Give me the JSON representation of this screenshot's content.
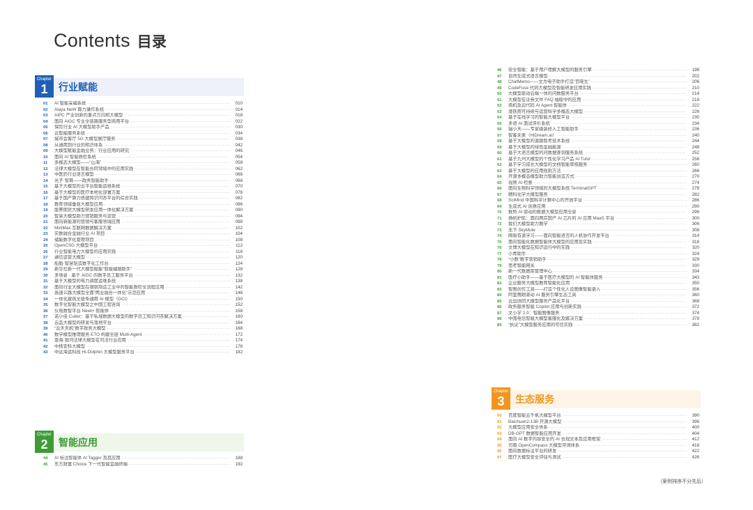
{
  "title": {
    "en": "Contents",
    "cn": "目录"
  },
  "chapters": [
    {
      "label": "Chapter",
      "number": "1",
      "title": "行业赋能",
      "color": "#1f5fb5",
      "items": [
        {
          "n": "01",
          "t": "AI 智能采编系统",
          "p": "010"
        },
        {
          "n": "02",
          "t": "Alaya NeW 算力操作系统",
          "p": "014"
        },
        {
          "n": "03",
          "t": "AIPC 产业创新的重点方向和大模型",
          "p": "018"
        },
        {
          "n": "04",
          "t": "面向 AIGC 专业全链路服务型商用平台",
          "p": "022"
        },
        {
          "n": "05",
          "t": "保险行业 AI 大模型助手产品",
          "p": "030"
        },
        {
          "n": "06",
          "t": "云智能服务系统",
          "p": "034"
        },
        {
          "n": "07",
          "t": "城市会客厅 5G 大模型展厅服务",
          "p": "038"
        },
        {
          "n": "08",
          "t": "从通用到行业的知识体系",
          "p": "042"
        },
        {
          "n": "09",
          "t": "大模型赋能金融业务：行业应用的研究",
          "p": "046"
        },
        {
          "n": "10",
          "t": "面向 AI 智能质检系统",
          "p": "054"
        },
        {
          "n": "11",
          "t": "多模态大模型——“山海”",
          "p": "058"
        },
        {
          "n": "12",
          "t": "法律大模型在智能合同领域中的应用实践",
          "p": "062"
        },
        {
          "n": "13",
          "t": "中医药行业语言模型",
          "p": "066"
        },
        {
          "n": "14",
          "t": "光子·智算——政务智能助手",
          "p": "068"
        },
        {
          "n": "15",
          "t": "基于大模型的云平台智能运维系统",
          "p": "070"
        },
        {
          "n": "16",
          "t": "基于大模型的医疗本地化部署方案",
          "p": "076"
        },
        {
          "n": "17",
          "t": "基于国产算力搭建知识问答平台的综合实践",
          "p": "082"
        },
        {
          "n": "18",
          "t": "教育领域垂直大模型应用",
          "p": "086"
        },
        {
          "n": "19",
          "t": "股票期货大模型研发应用一体化解决方案",
          "p": "090"
        },
        {
          "n": "20",
          "t": "智慧大模型助力营销服务与运营",
          "p": "094"
        },
        {
          "n": "21",
          "t": "面向新能源的营销与客服领域应用",
          "p": "098"
        },
        {
          "n": "22",
          "t": "MiniMax 互联网数据解决方案",
          "p": "102"
        },
        {
          "n": "23",
          "t": "实数融合金融行业 AI 项目",
          "p": "104"
        },
        {
          "n": "24",
          "t": "储能数字化管理项目",
          "p": "108"
        },
        {
          "n": "25",
          "t": "OpenCSG 大模型平台",
          "p": "112"
        },
        {
          "n": "26",
          "t": "行业智能电力大模型的应用实践",
          "p": "118"
        },
        {
          "n": "27",
          "t": "通信运营大模型",
          "p": "120"
        },
        {
          "n": "28",
          "t": "船舶·智慧制造数字化工作台",
          "p": "124"
        },
        {
          "n": "29",
          "t": "新华社新一代大模型赋能“智能编辑助手”",
          "p": "128"
        },
        {
          "n": "30",
          "t": "多场景 · 基于 AIGC 的数字员工服务平台",
          "p": "132"
        },
        {
          "n": "31",
          "t": "基于大模型的电力调度运维系统",
          "p": "138"
        },
        {
          "n": "32",
          "t": "面向行业大模型在钢铁制造工业中的智能质检全流程应用",
          "p": "142"
        },
        {
          "n": "33",
          "t": "高速公路大模型全面“两业融合一体化”示范应用",
          "p": "146"
        },
        {
          "n": "34",
          "t": "一体化建筑全链条通用 AI 模型（GCI）",
          "p": "150"
        },
        {
          "n": "35",
          "t": "数字化智能大模型之中国工程咨询",
          "p": "152"
        },
        {
          "n": "36",
          "t": "仪电数智平台 Newt+ 智能体",
          "p": "158"
        },
        {
          "n": "37",
          "t": "诺小佳 Cuber：基于私域数据大模型的数字员工知识问答解决方案",
          "p": "160"
        },
        {
          "n": "38",
          "t": "云品大模型的研发与落地平台",
          "p": "164"
        },
        {
          "n": "39",
          "t": "“云天天机”数字政务大模型",
          "p": "168"
        },
        {
          "n": "40",
          "t": "数学模型推理服务 ETO 构建全链 Multi-Agent",
          "p": "172"
        },
        {
          "n": "41",
          "t": "恩海·银河法律大模型在司法行业应用",
          "p": "174"
        },
        {
          "n": "42",
          "t": "中核安科大模型",
          "p": "178"
        },
        {
          "n": "43",
          "t": "中远海运科技 Hi-Dolphin 大模型服务平台",
          "p": "182"
        }
      ]
    },
    {
      "label": "Chapter",
      "number": "2",
      "title": "智能应用",
      "color": "#3f9a37",
      "items": [
        {
          "n": "44",
          "t": "AI 标注智能体 AI Tagger 及其应用",
          "p": "188"
        },
        {
          "n": "45",
          "t": "东方财富 Choice 下一代智能金融终端",
          "p": "192"
        },
        {
          "n": "46",
          "t": "安全智能：基于用户理解大模型的服务引擎",
          "p": "198"
        },
        {
          "n": "47",
          "t": "自然生成式语言模型",
          "p": "202"
        },
        {
          "n": "48",
          "t": "ChatMemo——文为电子助手打造“百晓生”",
          "p": "206"
        },
        {
          "n": "49",
          "t": "CodeFuse 代码大模型及智能研发应用实践",
          "p": "210"
        },
        {
          "n": "50",
          "t": "大模型驱动云端一体的问数服务平台",
          "p": "214"
        },
        {
          "n": "51",
          "t": "大模型在证券文件 FAQ 抽取中的应用",
          "p": "218"
        },
        {
          "n": "52",
          "t": "商机急迫代码 AI Agent 智能体",
          "p": "222"
        },
        {
          "n": "53",
          "t": "港铁用可持续与运营科学多模态大模型",
          "p": "226"
        },
        {
          "n": "54",
          "t": "基于在线学习的智能大模型平台",
          "p": "230"
        },
        {
          "n": "55",
          "t": "多语 AI 面试评价系统",
          "p": "234"
        },
        {
          "n": "56",
          "t": "瑞小天——专家级装修入工智能助手",
          "p": "236"
        },
        {
          "n": "57",
          "t": "智客未来（HiDream.ai）",
          "p": "240"
        },
        {
          "n": "58",
          "t": "基于大模型的道路智考技术系统",
          "p": "244"
        },
        {
          "n": "59",
          "t": "基于大模型的绿色金融能源",
          "p": "248"
        },
        {
          "n": "60",
          "t": "基于大语言模型的问数据查询服务系统",
          "p": "252"
        },
        {
          "n": "61",
          "t": "基于九州大模型的个性化学习产品 AI Tutor",
          "p": "256"
        },
        {
          "n": "62",
          "t": "基于学习成长大模型的文档智能审核服务",
          "p": "260"
        },
        {
          "n": "63",
          "t": "基于大模型的应用规则方法",
          "p": "266"
        },
        {
          "n": "64",
          "t": "开源多模态模型助力智能创造方式",
          "p": "270"
        },
        {
          "n": "65",
          "t": "视频 AI 检索",
          "p": "274"
        },
        {
          "n": "66",
          "t": "面向生物科学领域的大模型系统 TerminalGPT",
          "p": "278"
        },
        {
          "n": "67",
          "t": "精科化学大模型服务",
          "p": "282"
        },
        {
          "n": "68",
          "t": "SciMind 中国科学计算中心的开放平台",
          "p": "286"
        },
        {
          "n": "69",
          "t": "生成式 AI 创意应用",
          "p": "290"
        },
        {
          "n": "70",
          "t": "数势 AI 驱动的数据大模型应用全景",
          "p": "296"
        },
        {
          "n": "71",
          "t": "扬帆护航：面向两岸国产 AI 芯片的 AI 应用 MaaS 平台",
          "p": "300"
        },
        {
          "n": "72",
          "t": "我们大模型助力教学",
          "p": "306"
        },
        {
          "n": "73",
          "t": "无下 SkyMute",
          "p": "308"
        },
        {
          "n": "74",
          "t": "网易有道学习——面向智能语言的人机协作开发平台",
          "p": "314"
        },
        {
          "n": "75",
          "t": "面向智能化数据智能体大模型的应用及实践",
          "p": "318"
        },
        {
          "n": "76",
          "t": "文博大模型在知识运行中的实践",
          "p": "320"
        },
        {
          "n": "77",
          "t": "小青助手",
          "p": "324"
        },
        {
          "n": "78",
          "t": "“小数”数字营销助手",
          "p": "329"
        },
        {
          "n": "79",
          "t": "思考智能网关",
          "p": "330"
        },
        {
          "n": "80",
          "t": "新一代数据库管理中心",
          "p": "334"
        },
        {
          "n": "81",
          "t": "医疗小助手——基于医疗大模型的 AI 智能体服务",
          "p": "343"
        },
        {
          "n": "82",
          "t": "企业服务大模型教育智能化应用",
          "p": "350"
        },
        {
          "n": "83",
          "t": "智图创作工具——打造个性化人设图像智能录入",
          "p": "356"
        },
        {
          "n": "84",
          "t": "阿里鹰眼驱动 AI 服务引擎生态工具",
          "p": "360"
        },
        {
          "n": "85",
          "t": "云边协同大模型服务产品化平台",
          "p": "368"
        },
        {
          "n": "86",
          "t": "政务服务智能 Copilot 应用与创新实践",
          "p": "372"
        },
        {
          "n": "87",
          "t": "文小学 2.0：智能图像服务",
          "p": "374"
        },
        {
          "n": "88",
          "t": "中国电信智能大模型客服化及解决方案",
          "p": "378"
        },
        {
          "n": "89",
          "t": "“执证”大模型服务应用的可信实践",
          "p": "382"
        }
      ]
    },
    {
      "label": "Chapter",
      "number": "3",
      "title": "生态服务",
      "color": "#f0961e",
      "items": [
        {
          "n": "90",
          "t": "百度智能云千帆大模型平台",
          "p": "390"
        },
        {
          "n": "91",
          "t": "Baichuan2-13B 开源大模型",
          "p": "396"
        },
        {
          "n": "92",
          "t": "大模型应用安全体系",
          "p": "400"
        },
        {
          "n": "93",
          "t": "DB-GPT 数据智能应用开发",
          "p": "404"
        },
        {
          "n": "94",
          "t": "面向 AI 数字内容安全的 AI 合规文本及应用框架",
          "p": "412"
        },
        {
          "n": "95",
          "t": "司南 OpenCompass 大模型评测体系",
          "p": "418"
        },
        {
          "n": "96",
          "t": "面向数据标注平台的研发",
          "p": "422"
        },
        {
          "n": "97",
          "t": "医疗大模型安全评估与测试",
          "p": "426"
        }
      ]
    }
  ],
  "footnote": "（案例排序不分先后）"
}
